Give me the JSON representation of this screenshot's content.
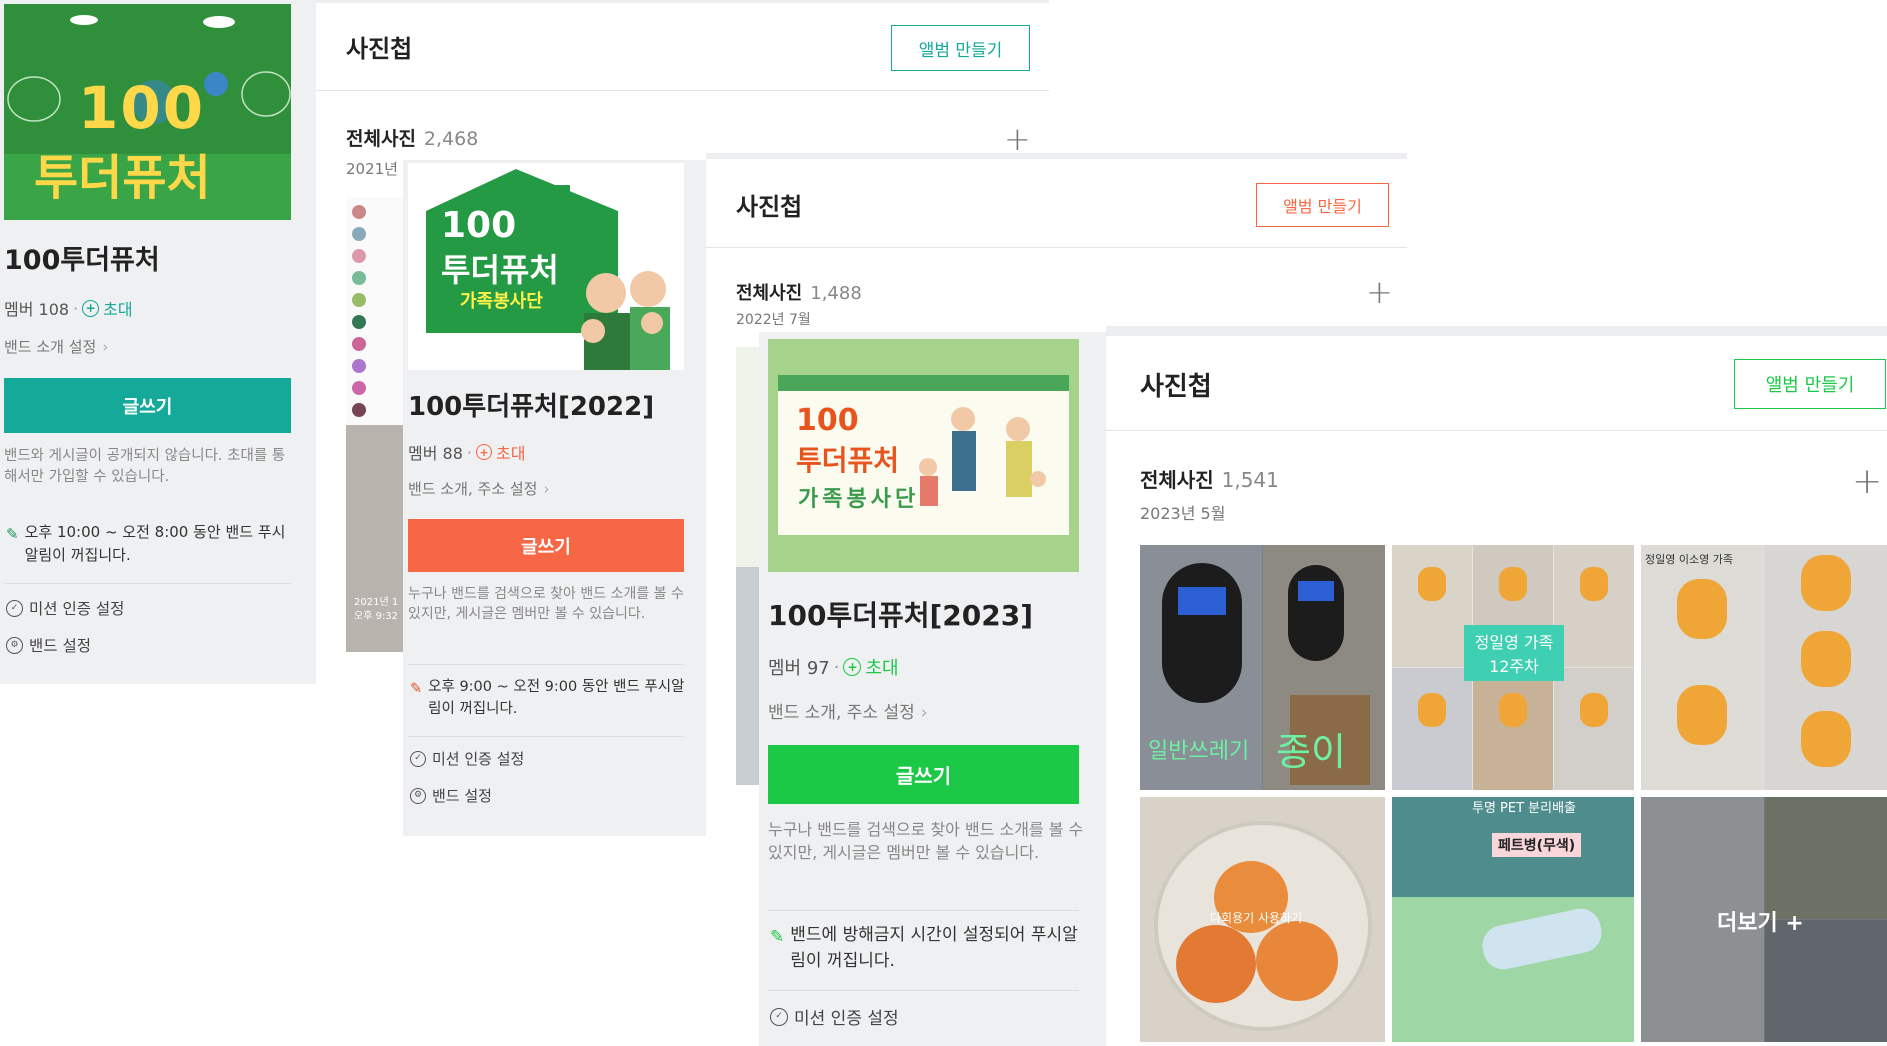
{
  "bands": [
    {
      "name": "100투더퓨처",
      "member_label": "멤버 108",
      "invite_label": "초대",
      "settings_link": "밴드 소개 설정",
      "write_button": "글쓰기",
      "notice": "밴드와 게시글이 공개되지 않습니다. 초대를 통해서만 가입할 수 있습니다.",
      "alarm": "오후 10:00 ~ 오전 8:00 동안 밴드 푸시알림이 꺼집니다.",
      "mission_setting": "미션 인증 설정",
      "band_setting": "밴드 설정",
      "cover_text": {
        "number": "100",
        "title": "투더퓨처"
      },
      "accent_color": "#15a99a",
      "album": {
        "title": "사진첩",
        "create_button": "앨범 만들기",
        "all_photos_label": "전체사진",
        "count": "2,468",
        "date": "2021년",
        "thumb_date": "2021년 1",
        "thumb_time": "오후 9:32"
      }
    },
    {
      "name": "100투더퓨처[2022]",
      "member_label": "멤버 88",
      "invite_label": "초대",
      "settings_link": "밴드 소개, 주소 설정",
      "write_button": "글쓰기",
      "notice": "누구나 밴드를 검색으로 찾아 밴드 소개를 볼 수 있지만, 게시글은 멤버만 볼 수 있습니다.",
      "alarm": "오후 9:00 ~ 오전 9:00 동안 밴드 푸시알림이 꺼집니다.",
      "mission_setting": "미션 인증 설정",
      "band_setting": "밴드 설정",
      "cover_text": {
        "number": "100",
        "title": "투더퓨처",
        "subtitle": "가족봉사단"
      },
      "accent_color": "#f76745",
      "album": {
        "title": "사진첩",
        "create_button": "앨범 만들기",
        "all_photos_label": "전체사진",
        "count": "1,488",
        "date": "2022년 7월"
      }
    },
    {
      "name": "100투더퓨처[2023]",
      "member_label": "멤버 97",
      "invite_label": "초대",
      "settings_link": "밴드 소개, 주소 설정",
      "write_button": "글쓰기",
      "notice": "누구나 밴드를 검색으로 찾아 밴드 소개를 볼 수 있지만, 게시글은 멤버만 볼 수 있습니다.",
      "alarm": "밴드에 방해금지 시간이 설정되어 푸시알림이 꺼집니다.",
      "mission_setting": "미션 인증 설정",
      "cover_text": {
        "number": "100",
        "title": "투더퓨처",
        "subtitle": "가족봉사단"
      },
      "accent_color": "#1cc947",
      "album": {
        "title": "사진첩",
        "create_button": "앨범 만들기",
        "all_photos_label": "전체사진",
        "count": "1,541",
        "date": "2023년 5월",
        "photos": [
          {
            "caption_left": "일반쓰레기",
            "caption_right": "종이"
          },
          {
            "caption": "정일영 가족 12주차"
          },
          {
            "caption": "정일영 이소영 가족"
          },
          {
            "caption": "다회용기 사용하기"
          },
          {
            "caption_top": "투명 PET 분리배출",
            "label": "페트병(무색)"
          },
          {
            "caption": "더보기 +"
          }
        ]
      }
    }
  ]
}
